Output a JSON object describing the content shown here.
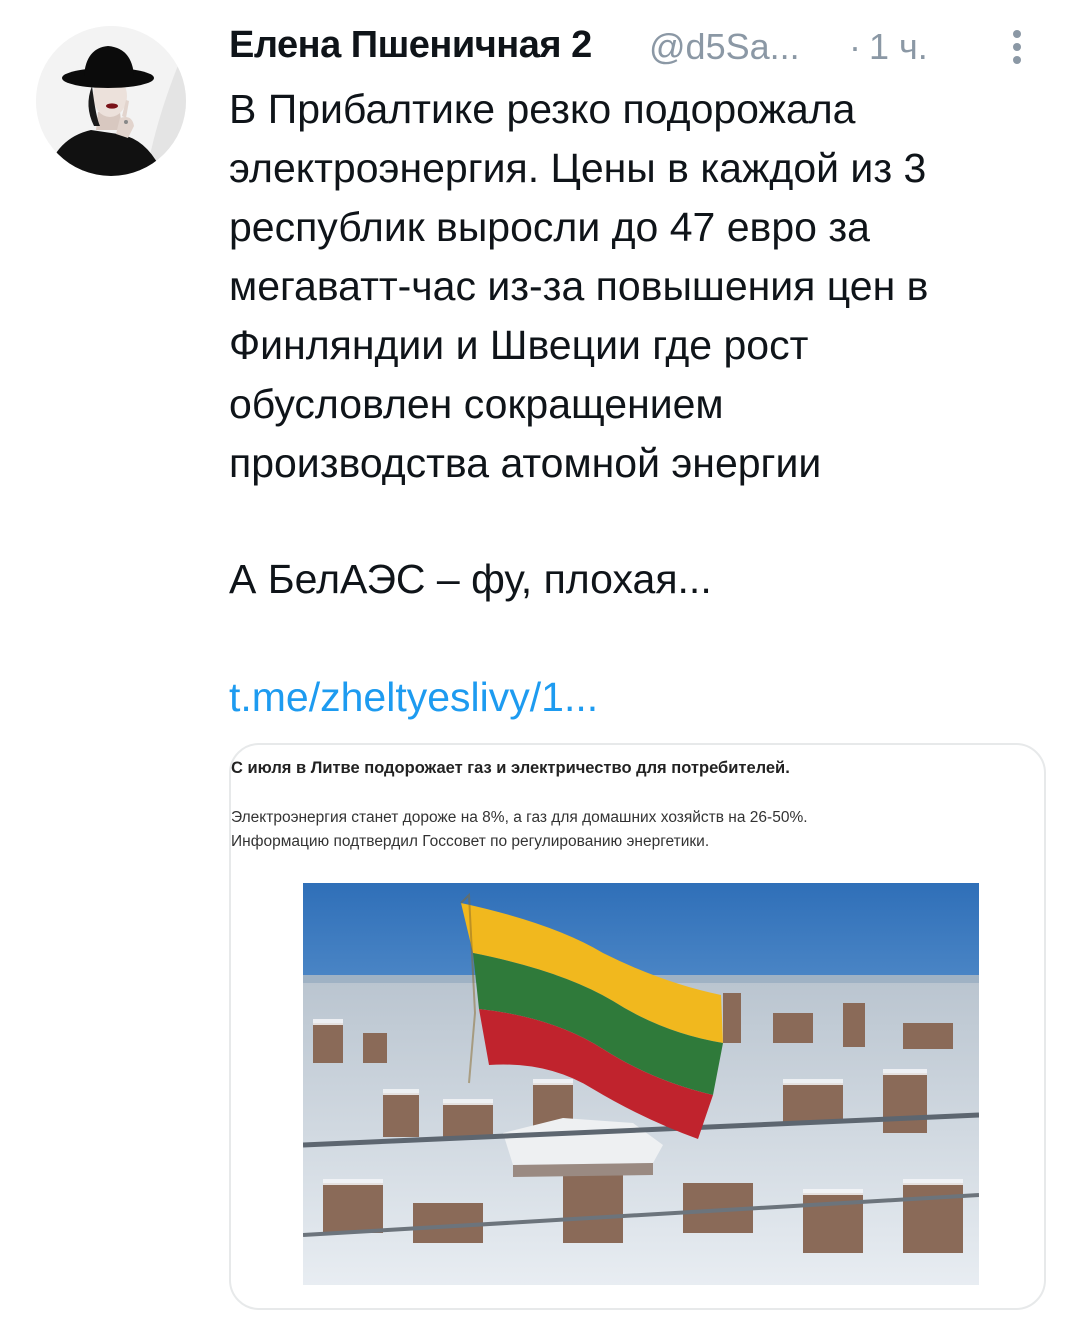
{
  "tweet": {
    "author_name": "Елена Пшеничная 2",
    "handle": "@d5Sa...",
    "separator": "·",
    "time": "1 ч.",
    "text_lines": [
      "В Прибалтике резко подорожала",
      "электроэнергия. Цены в каждой из 3",
      "республик выросли до 47 евро за",
      "мегаватт-час из-за повышения цен в",
      "Финляндии и Швеции где рост",
      "обусловлен сокращением",
      "производства атомной энергии"
    ],
    "second_paragraph": "А БелАЭС – фу, плохая...",
    "link_text": "t.me/zheltyeslivy/1...",
    "icons": {
      "avatar": "avatar-woman-black-hat",
      "more": "more-vertical-icon"
    }
  },
  "card": {
    "headline": "С июля в Литве подорожает газ и электричество для потребителей.",
    "lead_lines": [
      "Электроэнергия станет дороже на 8%, а газ для домашних хозяйств на 26-50%.",
      "Информацию подтвердил Госсовет по регулированию энергетики."
    ],
    "image": "lithuanian-flag-over-snowy-city"
  },
  "colors": {
    "text": "#0f1419",
    "muted": "#8b98a5",
    "link": "#1d9bf0",
    "border": "#e7e9ea",
    "flag_yellow": "#f1b81e",
    "flag_green": "#2f7a3a",
    "flag_red": "#c0232d"
  }
}
